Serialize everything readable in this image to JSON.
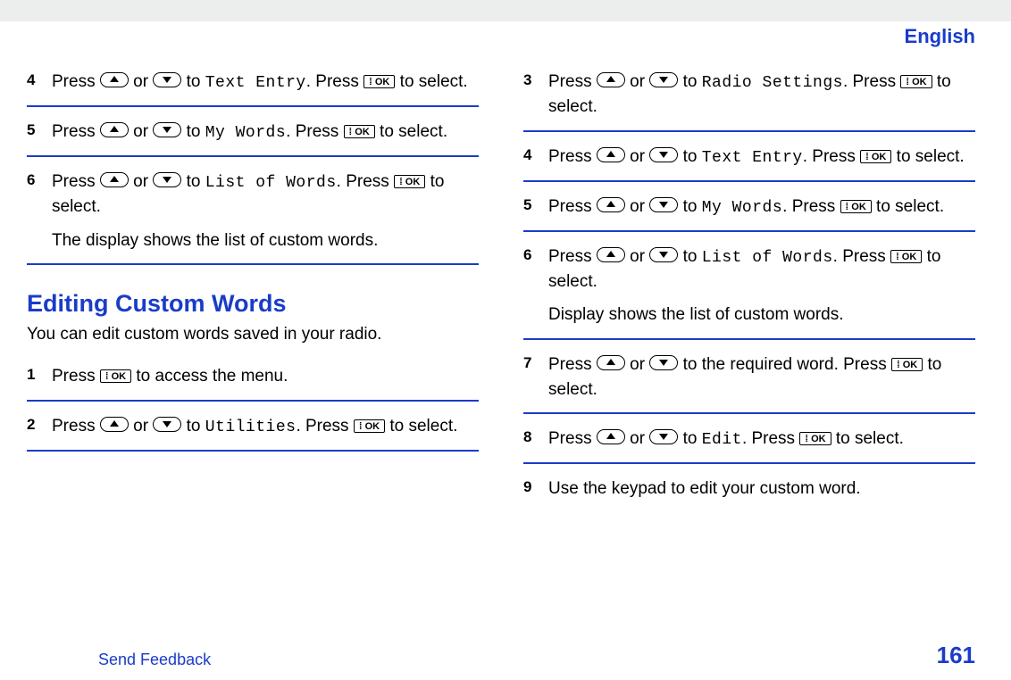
{
  "header": {
    "language": "English"
  },
  "left": {
    "steps": [
      {
        "num": "4",
        "pre": "Press ",
        "mid": " or ",
        "post1": " to ",
        "menu": "Text Entry",
        "post2": ". Press ",
        "tail": " to select.",
        "extra": ""
      },
      {
        "num": "5",
        "pre": "Press ",
        "mid": " or ",
        "post1": " to ",
        "menu": "My Words",
        "post2": ". Press ",
        "tail": " to select.",
        "extra": ""
      },
      {
        "num": "6",
        "pre": "Press ",
        "mid": " or ",
        "post1": " to ",
        "menu": "List of Words",
        "post2": ". Press ",
        "tail": " to select.",
        "extra": "The display shows the list of custom words."
      }
    ],
    "section_title": "Editing Custom Words",
    "section_intro": "You can edit custom words saved in your radio.",
    "steps2": [
      {
        "num": "1",
        "simple_pre": "Press ",
        "simple_post": " to access the menu."
      },
      {
        "num": "2",
        "pre": "Press ",
        "mid": " or ",
        "post1": " to ",
        "menu": "Utilities",
        "post2": ". Press ",
        "tail": " to select."
      }
    ]
  },
  "right": {
    "steps": [
      {
        "num": "3",
        "pre": "Press ",
        "mid": " or ",
        "post1": " to ",
        "menu": "Radio Settings",
        "post2": ". Press ",
        "tail": " to select.",
        "extra": ""
      },
      {
        "num": "4",
        "pre": "Press ",
        "mid": " or ",
        "post1": " to ",
        "menu": "Text Entry",
        "post2": ". Press ",
        "tail": " to select.",
        "extra": ""
      },
      {
        "num": "5",
        "pre": "Press ",
        "mid": " or ",
        "post1": " to ",
        "menu": "My Words",
        "post2": ". Press ",
        "tail": " to select.",
        "extra": ""
      },
      {
        "num": "6",
        "pre": "Press ",
        "mid": " or ",
        "post1": " to ",
        "menu": "List of Words",
        "post2": ". Press ",
        "tail": " to select.",
        "extra": "Display shows the list of custom words."
      },
      {
        "num": "7",
        "pre": "Press ",
        "mid": " or ",
        "post1": " to the required word. Press ",
        "menu": "",
        "post2": "",
        "tail": " to select.",
        "extra": "",
        "no_menu": true
      },
      {
        "num": "8",
        "pre": "Press ",
        "mid": " or ",
        "post1": " to ",
        "menu": "Edit",
        "post2": ". Press ",
        "tail": " to select.",
        "extra": ""
      },
      {
        "num": "9",
        "plain": "Use the keypad to edit your custom word."
      }
    ]
  },
  "footer": {
    "feedback": "Send Feedback",
    "page": "161"
  },
  "buttons": {
    "ok": "⁞ OK"
  }
}
